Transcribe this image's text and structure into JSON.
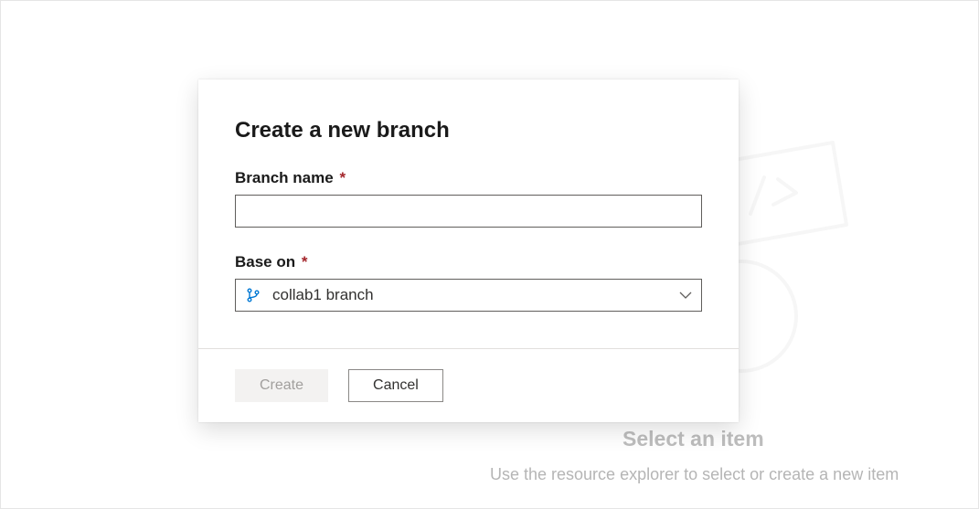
{
  "dialog": {
    "title": "Create a new branch",
    "branch_name": {
      "label": "Branch name",
      "value": ""
    },
    "base_on": {
      "label": "Base on",
      "selected": "collab1 branch"
    },
    "required_marker": "*",
    "actions": {
      "create_label": "Create",
      "cancel_label": "Cancel"
    }
  },
  "backdrop": {
    "title": "Select an item",
    "subtitle": "Use the resource explorer to select or create a new item"
  }
}
